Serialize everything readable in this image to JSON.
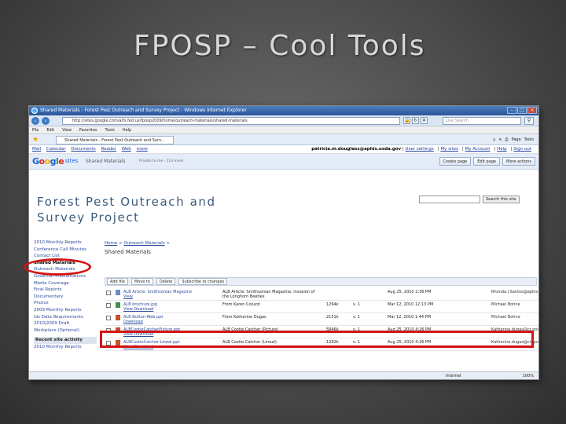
{
  "slide": {
    "title": "FPOSP – Cool Tools"
  },
  "browser": {
    "window_title": "Shared Materials - Forest Pest Outreach and Survey Project - Windows Internet Explorer",
    "url": "http://sites.google.com/a/fs.fed.us/fposp2009/home/outreach-materials/shared-materials",
    "live_search_placeholder": "Live Search",
    "menu": [
      "File",
      "Edit",
      "View",
      "Favorites",
      "Tools",
      "Help"
    ],
    "tab_label": "Shared Materials - Forest Pest Outreach and Surv...",
    "page_menu": "Page",
    "tools_menu": "Tools",
    "status_zone": "Internet",
    "zoom": "100%"
  },
  "google_bar": {
    "links": [
      "Mail",
      "Calendar",
      "Documents",
      "Reader",
      "Web",
      "more"
    ],
    "user_email": "patricia.m.douglass@aphis.usda.gov",
    "user_links": [
      "User settings",
      "My sites",
      "My Account",
      "Help",
      "Sign out"
    ]
  },
  "sites_bar": {
    "sites_word": "sites",
    "page": "Shared Materials",
    "sharing": "Private to me · 114 more",
    "buttons": [
      "Create page",
      "Edit page",
      "More actions"
    ]
  },
  "site": {
    "title": "Forest Pest Outreach and Survey Project",
    "search_button": "Search this site"
  },
  "sidebar": {
    "items": [
      "2010 Monthly Reports",
      "Conference Call Minutes",
      "Contact List",
      "Shared Materials",
      "Outreach Materials",
      "Governor Proclamations",
      "Media Coverage",
      "Final Reports",
      "Documentary",
      "Photos",
      "2009 Monthly Reports",
      "Ids Data Requirements",
      "2010/2009 Draft",
      "Workplans (Optional)"
    ],
    "recent": "Recent site activity",
    "recent_items": [
      "2010 Monthly Reports"
    ]
  },
  "content": {
    "breadcrumb_home": "Home",
    "breadcrumb_parent": "Outreach Materials",
    "page_name": "Shared Materials",
    "actions": [
      "Add file",
      "Move to",
      "Delete",
      "Subscribe to changes"
    ],
    "files": [
      {
        "name": "ALB Article: Smithsonian Magazine",
        "links": "View",
        "description": "ALB Article: Smithsonian Magazine, invasion of the Longhorn Beetles",
        "size": "",
        "version": "",
        "date": "Aug 25, 2010 2:36 PM",
        "user": "Rhonda.l.Santos@aphis.usda.gov"
      },
      {
        "name": "ALB brochure.jpg",
        "links": "View Download",
        "description": "From Karen Coluzzi",
        "size": "1294k",
        "version": "v. 1",
        "date": "Mar 12, 2010 12:13 PM",
        "user": "Michael Bohne"
      },
      {
        "name": "ALB Button-Web.ppt",
        "links": "Download",
        "description": "From Katherine Dugas",
        "size": "2151k",
        "version": "v. 1",
        "date": "Mar 12, 2010 1:44 PM",
        "user": "Michael Bohne"
      },
      {
        "name": "ALBCootieCatcherPicture.ppt",
        "links": "View Download",
        "description": "ALB Cootie Catcher (Picture)",
        "size": "5846k",
        "version": "v. 1",
        "date": "Aug 25, 2010 4:26 PM",
        "user": "Katherine.dugas@ct.gov"
      },
      {
        "name": "ALBCootieCatcher-Lineal.ppt",
        "links": "View Download",
        "description": "ALB Cootie Catcher (Lineal)",
        "size": "1292k",
        "version": "v. 1",
        "date": "Aug 25, 2010 4:26 PM",
        "user": "Katherine.dugas@ct.gov"
      }
    ]
  },
  "colors": {
    "highlight": "#d21414",
    "link": "#2a4d9c",
    "title_text": "#d8d8d8"
  }
}
